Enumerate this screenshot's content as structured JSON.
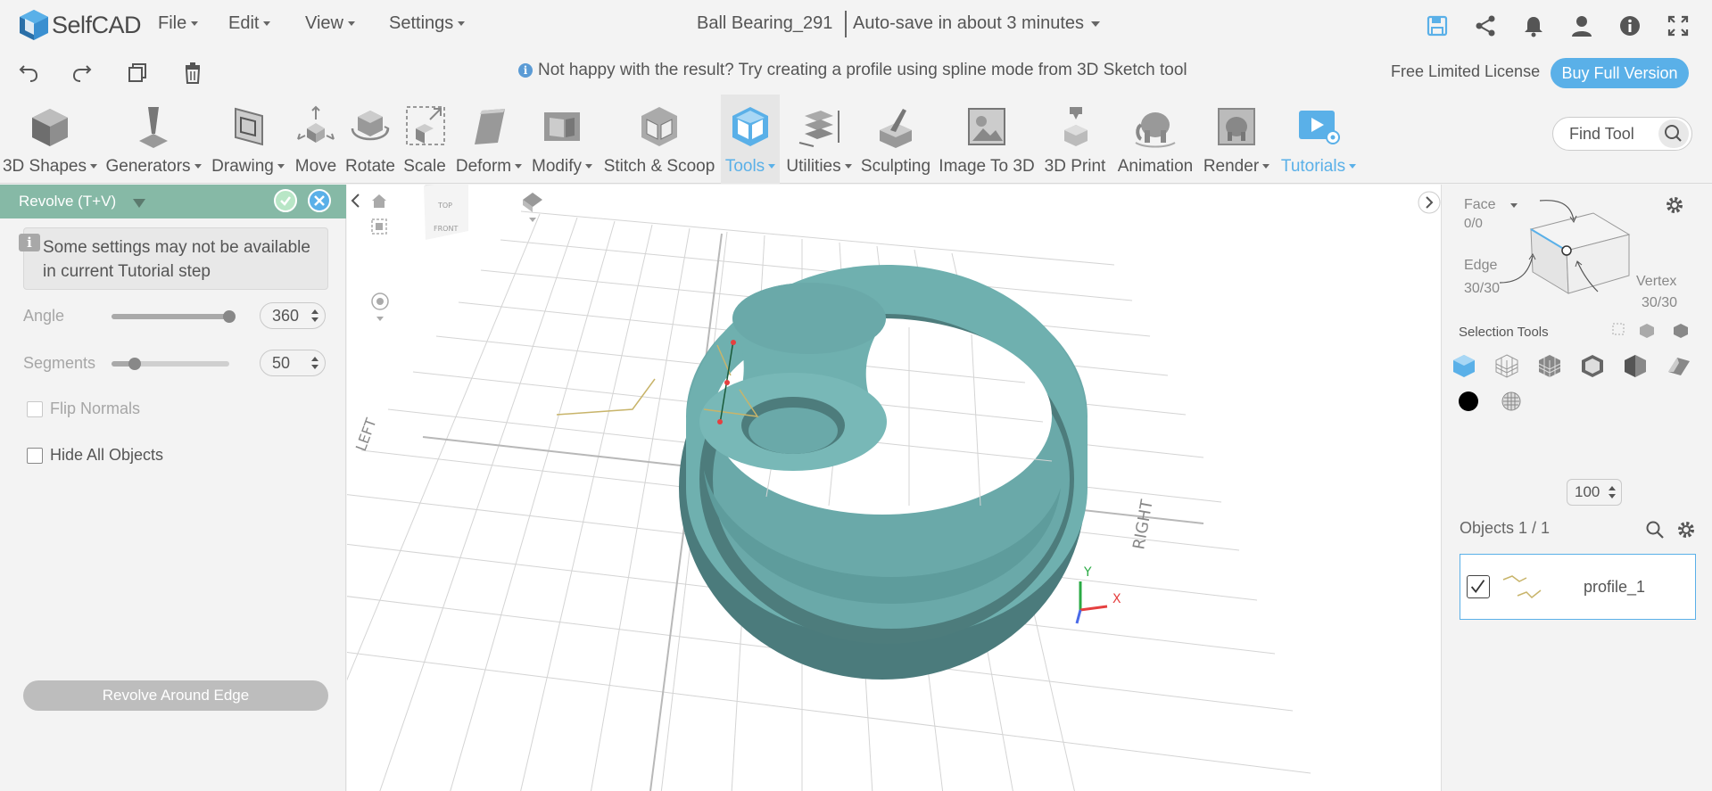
{
  "app": {
    "name": "SelfCAD"
  },
  "menubar": {
    "menus": [
      "File",
      "Edit",
      "View",
      "Settings"
    ],
    "doc_title": "Ball Bearing_291",
    "autosave": "Auto-save in about 3 minutes"
  },
  "row2": {
    "hint": "Not happy with the result? Try creating a profile using spline mode from 3D Sketch tool",
    "license": "Free Limited License",
    "buy_label": "Buy Full Version"
  },
  "toolbar": {
    "tools": [
      {
        "label": "3D Shapes",
        "icon": "cube-icon",
        "dropdown": true
      },
      {
        "label": "Generators",
        "icon": "generators-icon",
        "dropdown": true
      },
      {
        "label": "Drawing",
        "icon": "drawing-icon",
        "dropdown": true
      },
      {
        "label": "Move",
        "icon": "move-icon",
        "dropdown": false
      },
      {
        "label": "Rotate",
        "icon": "rotate-icon",
        "dropdown": false
      },
      {
        "label": "Scale",
        "icon": "scale-icon",
        "dropdown": false
      },
      {
        "label": "Deform",
        "icon": "deform-icon",
        "dropdown": true
      },
      {
        "label": "Modify",
        "icon": "modify-icon",
        "dropdown": true
      },
      {
        "label": "Stitch & Scoop",
        "icon": "stitch-scoop-icon",
        "dropdown": false
      },
      {
        "label": "Tools",
        "icon": "tools-icon",
        "dropdown": true,
        "active": true
      },
      {
        "label": "Utilities",
        "icon": "utilities-icon",
        "dropdown": true
      },
      {
        "label": "Sculpting",
        "icon": "sculpting-icon",
        "dropdown": false
      },
      {
        "label": "Image To 3D",
        "icon": "image-to-3d-icon",
        "dropdown": false
      },
      {
        "label": "3D Print",
        "icon": "3d-print-icon",
        "dropdown": false
      },
      {
        "label": "Animation",
        "icon": "animation-icon",
        "dropdown": false
      },
      {
        "label": "Render",
        "icon": "render-icon",
        "dropdown": true
      },
      {
        "label": "Tutorials",
        "icon": "tutorials-icon",
        "dropdown": true,
        "highlight": true
      }
    ],
    "find_placeholder": "Find Tool"
  },
  "left_panel": {
    "title": "Revolve (T+V)",
    "notice": "Some settings may not be available in current Tutorial step",
    "angle": {
      "label": "Angle",
      "value": "360",
      "fraction": 1.0
    },
    "segments": {
      "label": "Segments",
      "value": "50",
      "fraction": 0.2
    },
    "flip_normals": {
      "label": "Flip Normals",
      "checked": false
    },
    "hide_all": {
      "label": "Hide All Objects",
      "checked": false
    },
    "revolve_button": "Revolve Around Edge"
  },
  "viewport": {
    "view_cube": {
      "top": "TOP",
      "front": "FRONT"
    },
    "axis_labels": {
      "left": "LEFT",
      "right": "RIGHT"
    },
    "gizmo": {
      "x": "X",
      "y": "Y"
    },
    "colors": {
      "model": "#6fb0af",
      "model_dark": "#4d7c7c",
      "grid": "#cfcfcf"
    }
  },
  "right_panel": {
    "face_label": "Face",
    "face_count": "0/0",
    "edge_label": "Edge",
    "edge_count": "30/30",
    "vertex_label": "Vertex",
    "vertex_count": "30/30",
    "selection_tools_label": "Selection Tools",
    "opacity": "100",
    "objects_title": "Objects 1 / 1",
    "object_name": "profile_1"
  },
  "colors": {
    "accent": "#5ab0e8",
    "panel_header": "#86b9a6"
  }
}
